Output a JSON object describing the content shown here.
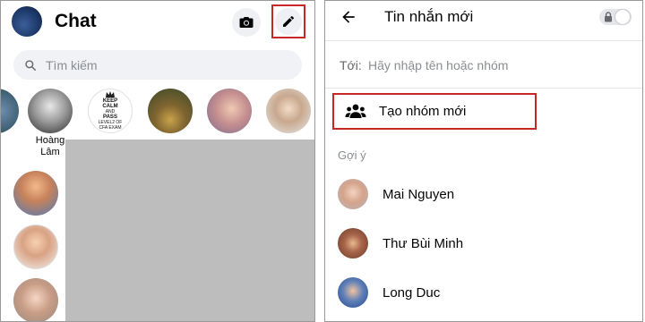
{
  "left_panel": {
    "title": "Chat",
    "search_placeholder": "Tìm kiếm",
    "stories": [
      {
        "name": ""
      },
      {
        "name": "Hoàng\nLâm"
      },
      {
        "name": ""
      },
      {
        "name": ""
      },
      {
        "name": ""
      },
      {
        "name": ""
      }
    ],
    "poster_text": [
      "KEEP",
      "CALM",
      "AND",
      "PASS",
      "LEVEL2 OF",
      "CFA EXAM"
    ]
  },
  "right_panel": {
    "title": "Tin nhắn mới",
    "to_label": "Tới:",
    "to_placeholder": "Hãy nhập tên hoặc nhóm",
    "create_group_label": "Tạo nhóm mới",
    "suggestions_title": "Gợi ý",
    "suggestions": [
      {
        "name": "Mai Nguyen"
      },
      {
        "name": "Thư Bùi Minh"
      },
      {
        "name": "Long Duc"
      }
    ]
  },
  "colors": {
    "highlight_border": "#c62828",
    "search_bg": "#f0f2f5",
    "redaction": "#bdbdbd"
  },
  "icons": {
    "camera": "camera-icon",
    "compose": "pencil-icon",
    "search": "search-icon",
    "back": "back-arrow-icon",
    "lock": "lock-icon",
    "group": "people-icon"
  }
}
